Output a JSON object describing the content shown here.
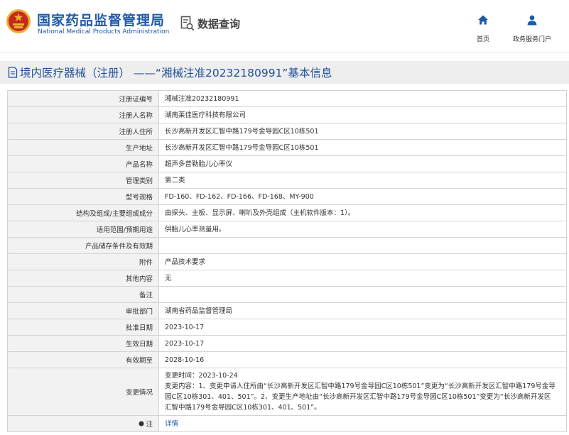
{
  "header": {
    "org_cn": "国家药品监督管理局",
    "org_en": "National Medical Products Administration",
    "query_label": "数据查询",
    "nav": [
      {
        "label": "首页",
        "icon": "home-icon"
      },
      {
        "label": "政务服务门户",
        "icon": "user-icon"
      }
    ]
  },
  "page_title": "境内医疗器械（注册） ——“湘械注准20232180991”基本信息",
  "colors": {
    "brand_blue": "#1f5aa6",
    "title_blue": "#1f4f99",
    "emblem_red": "#c8281e",
    "emblem_gold": "#e8b42c"
  },
  "rows": [
    {
      "label": "注册证编号",
      "value": "湘械注准20232180991"
    },
    {
      "label": "注册人名称",
      "value": "湖南莱佳医疗科技有限公司"
    },
    {
      "label": "注册人住所",
      "value": "长沙高新开发区汇智中路179号金导园C区10栋501"
    },
    {
      "label": "生产地址",
      "value": "长沙高新开发区汇智中路179号金导园C区10栋501"
    },
    {
      "label": "产品名称",
      "value": "超声多普勒胎儿心率仪"
    },
    {
      "label": "管理类别",
      "value": "第二类"
    },
    {
      "label": "型号规格",
      "value": "FD-160、FD-162、FD-166、FD-168、MY-900"
    },
    {
      "label": "结构及组成/主要组成成分",
      "value": "由探头、主板、显示屏、喇叭及外壳组成（主机软件版本：1）。"
    },
    {
      "label": "适用范围/预期用途",
      "value": "供胎儿心率测量用。"
    },
    {
      "label": "产品储存条件及有效期",
      "value": ""
    },
    {
      "label": "附件",
      "value": "产品技术要求"
    },
    {
      "label": "其他内容",
      "value": "无"
    },
    {
      "label": "备注",
      "value": ""
    },
    {
      "label": "审批部门",
      "value": "湖南省药品监督管理局"
    },
    {
      "label": "批准日期",
      "value": "2023-10-17"
    },
    {
      "label": "生效日期",
      "value": "2023-10-17"
    },
    {
      "label": "有效期至",
      "value": "2028-10-16"
    }
  ],
  "change": {
    "label": "变更情况",
    "lines": [
      "变更时间：2023-10-24",
      "变更内容：1、变更申请人住所由“长沙高新开发区汇智中路179号金导园C区10栋501”变更为“长沙高新开发区汇智中路179号金导",
      "园C区10栋301、401、501”。2、变更生产地址由“长沙高新开发区汇智中路179号金导园C区10栋501”变更为“长沙高新开发区",
      "汇智中路179号金导园C区10栋301、401、501”。"
    ]
  },
  "note": {
    "label": "注",
    "link": "详情",
    "icon": "info-dot-icon"
  }
}
